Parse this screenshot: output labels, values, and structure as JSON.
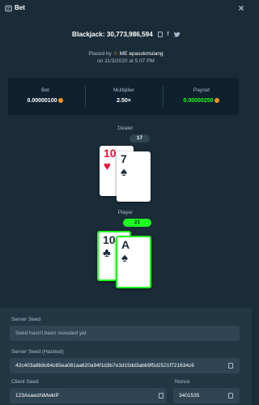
{
  "header": {
    "title": "Bet",
    "close_glyph": "×"
  },
  "bet": {
    "game": "Blackjack: 30,773,986,594",
    "placed_by_prefix": "Placed by",
    "badge_icon": "star-icon",
    "username": "ME epasokmulang",
    "placed_on": "on 11/3/2020 at 5:07 PM"
  },
  "stats": {
    "bet_label": "Bet",
    "bet_value": "0.00000100",
    "multiplier_label": "Multiplier",
    "multiplier_value": "2.50×",
    "payout_label": "Payout",
    "payout_value": "0.00000250",
    "payout_color": "#1fff20",
    "coin_color": "#f7931a"
  },
  "dealer": {
    "label": "Dealer",
    "score": "17",
    "cards": [
      {
        "rank": "10",
        "suit": "♥",
        "color": "red"
      },
      {
        "rank": "7",
        "suit": "♠",
        "color": "black"
      }
    ]
  },
  "player": {
    "label": "Player",
    "score": "21",
    "win_color": "#1fff20",
    "cards": [
      {
        "rank": "10",
        "suit": "♣",
        "color": "black"
      },
      {
        "rank": "A",
        "suit": "♠",
        "color": "black"
      }
    ]
  },
  "form": {
    "server_seed_label": "Server Seed",
    "server_seed_placeholder": "Seed hasn't been revealed yet",
    "server_seed_hashed_label": "Server Seed (Hashed)",
    "server_seed_hashed_value": "42c403a8b9c64c65ea081aa620a94f1d3b7e3d15dd3abb9f5d2521f721634c6",
    "client_seed_label": "Client Seed",
    "client_seed_value": "123AsawzNMwkiP",
    "nonce_label": "Nonce",
    "nonce_value": "3401535"
  }
}
